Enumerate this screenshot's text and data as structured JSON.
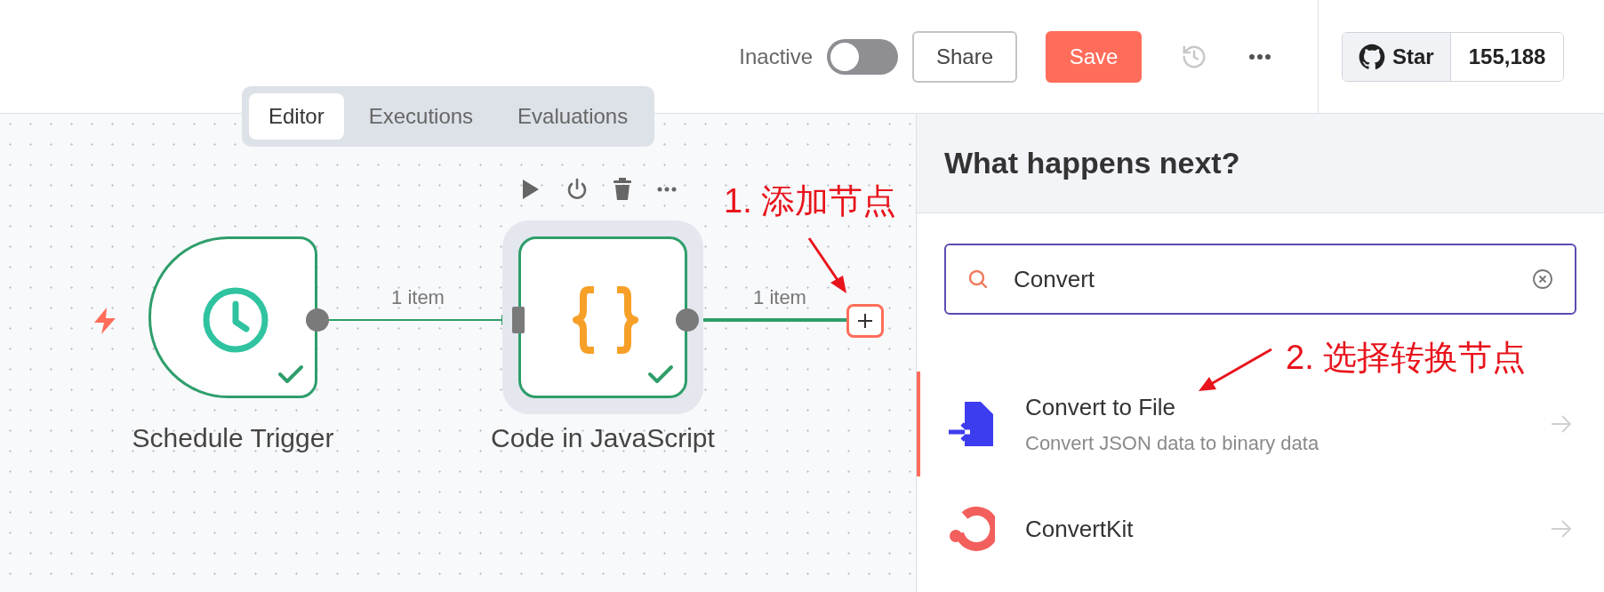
{
  "header": {
    "status_label": "Inactive",
    "active": false,
    "share": "Share",
    "save": "Save",
    "star_label": "Star",
    "star_count": "155,188"
  },
  "tabs": [
    {
      "label": "Editor",
      "selected": true
    },
    {
      "label": "Executions",
      "selected": false
    },
    {
      "label": "Evaluations",
      "selected": false
    }
  ],
  "canvas": {
    "nodes": [
      {
        "kind": "trigger",
        "name": "Schedule Trigger",
        "success": true,
        "selected": false
      },
      {
        "kind": "code",
        "name": "Code in JavaScript",
        "success": true,
        "selected": true
      }
    ],
    "edges": [
      {
        "label": "1 item"
      },
      {
        "label": "1 item"
      }
    ]
  },
  "annotations": [
    {
      "text": "1. 添加节点"
    },
    {
      "text": "2. 选择转换节点"
    }
  ],
  "panel": {
    "title": "What happens next?",
    "search": {
      "value": "Convert"
    },
    "results": [
      {
        "kind": "file",
        "name": "Convert to File",
        "description": "Convert JSON data to binary data",
        "selected": true
      },
      {
        "kind": "convertkit",
        "name": "ConvertKit",
        "selected": false
      }
    ]
  }
}
